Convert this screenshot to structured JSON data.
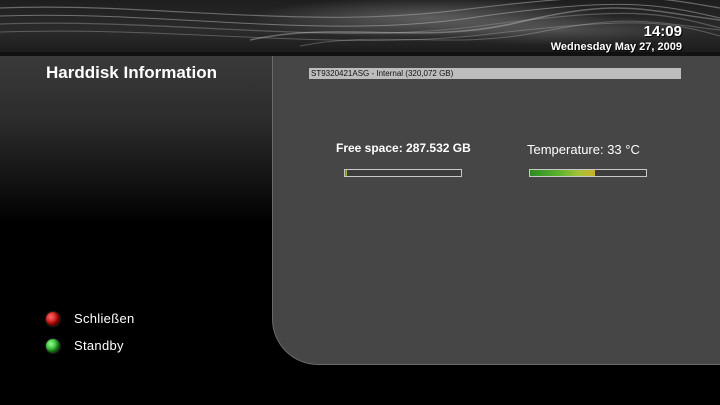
{
  "header": {
    "time": "14:09",
    "date": "Wednesday May 27, 2009"
  },
  "page": {
    "title": "Harddisk Information"
  },
  "disk": {
    "name": "ST9320421ASG - Internal (320,072 GB)",
    "free_space_label": "Free space: 287.532 GB",
    "free_space_used_fraction": 0.02,
    "temperature_label": "Temperature: 33 °C",
    "temperature_fraction": 0.56
  },
  "buttons": {
    "red": {
      "label": "Schließen",
      "color": "#c00000"
    },
    "green": {
      "label": "Standby",
      "color": "#1fa01f"
    }
  }
}
